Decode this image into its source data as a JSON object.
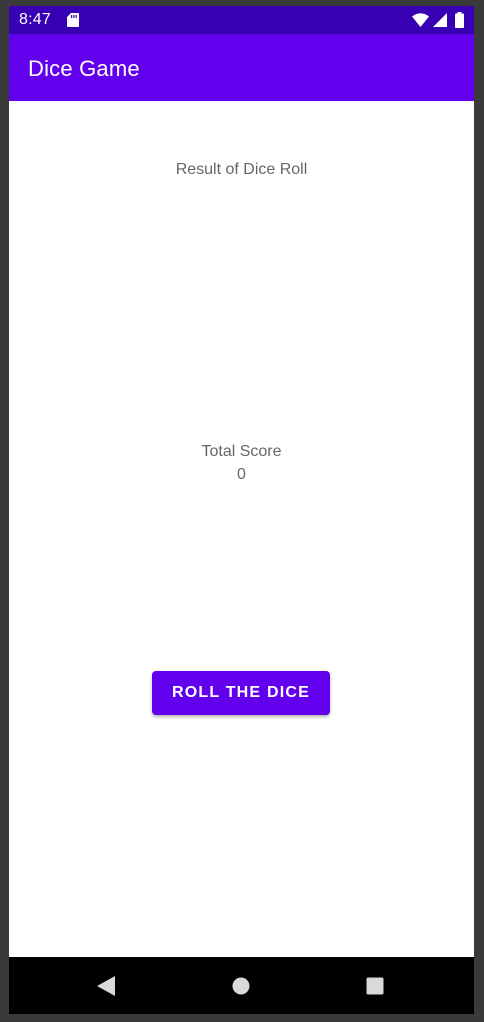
{
  "status_bar": {
    "time": "8:47",
    "icons": [
      "sd-card-icon",
      "wifi-icon",
      "signal-icon",
      "battery-icon"
    ]
  },
  "app_bar": {
    "title": "Dice Game"
  },
  "main": {
    "result_label": "Result of Dice Roll",
    "total_label": "Total Score",
    "total_value": "0",
    "roll_button_label": "ROLL THE DICE"
  },
  "nav_bar": {
    "icons": [
      "back-icon",
      "home-icon",
      "recents-icon"
    ]
  },
  "colors": {
    "primary": "#6200ee",
    "primary_dark": "#3700b3",
    "text_secondary": "#666666",
    "background": "#ffffff"
  }
}
